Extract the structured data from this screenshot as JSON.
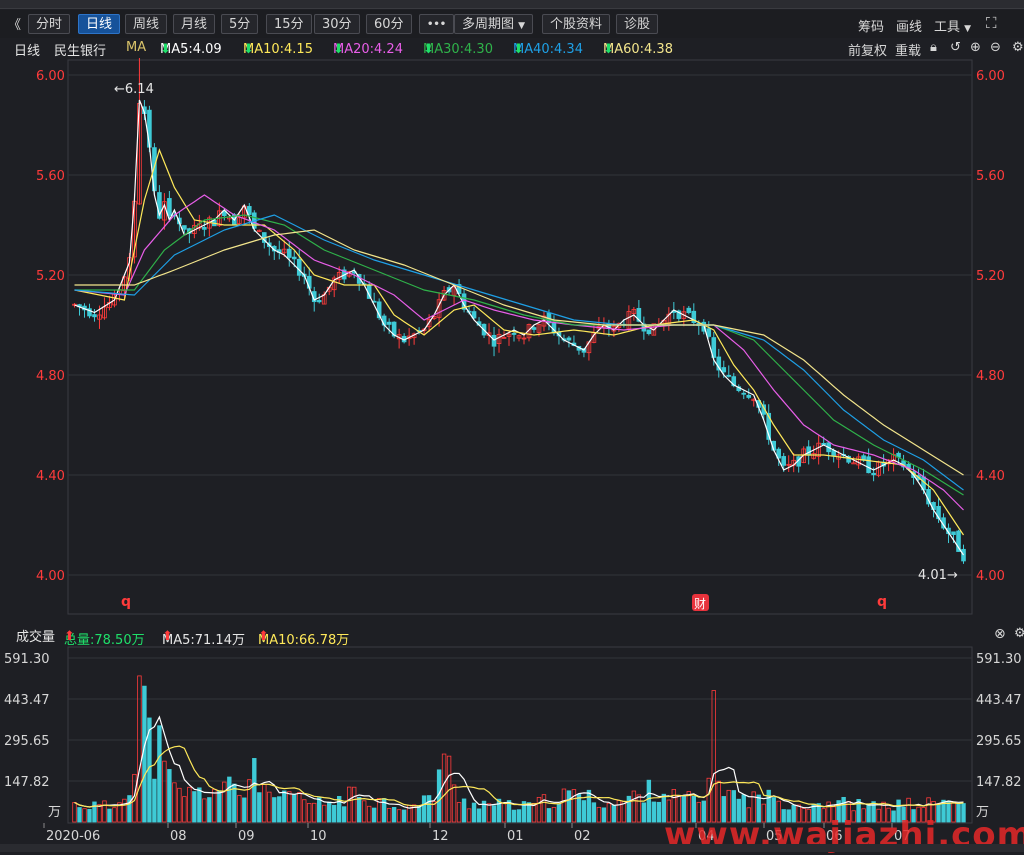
{
  "toolbar": {
    "collapse": "《",
    "tabs": [
      "分时",
      "日线",
      "周线",
      "月线",
      "5分",
      "15分",
      "30分",
      "60分"
    ],
    "active_tab": "日线",
    "more": "•••",
    "multi_period": "多周期图",
    "stock_info": "个股资料",
    "diagnose": "诊股",
    "chips": "筹码",
    "draw": "画线",
    "tools": "工具"
  },
  "info": {
    "period": "日线",
    "stock_name": "民生银行",
    "ma_label": "MA",
    "ma5": "MA5:4.09",
    "ma10": "MA10:4.15",
    "ma20": "MA20:4.24",
    "ma30": "MA30:4.30",
    "ma40": "MA40:4.34",
    "ma60": "MA60:4.38",
    "adjust": "前复权",
    "reload": "重载"
  },
  "volume_info": {
    "label": "成交量",
    "total": "总量:78.50万",
    "vma5": "MA5:71.14万",
    "vma10": "MA10:66.78万"
  },
  "colors": {
    "up": "#ff3b3b",
    "down": "#3ecad6",
    "ma5": "#ffffff",
    "ma10": "#ffe95a",
    "ma20": "#e85ee8",
    "ma30": "#2fb24a",
    "ma40": "#1ea0e6",
    "ma60": "#f3e58c"
  },
  "annotations": {
    "high": "←6.14",
    "low": "4.01→",
    "marker_q": "q",
    "marker_cai": "财"
  },
  "watermark": "www.wajiazhi.com",
  "chart_data": [
    {
      "type": "candlestick",
      "y_ticks": [
        "6.00",
        "5.60",
        "5.20",
        "4.80",
        "4.40",
        "4.00"
      ],
      "ylim": [
        4.0,
        6.2
      ],
      "price_path": [
        [
          0,
          5.08
        ],
        [
          4,
          5.05
        ],
        [
          8,
          5.1
        ],
        [
          11,
          5.25
        ],
        [
          12,
          5.5
        ],
        [
          13,
          5.9
        ],
        [
          14,
          5.85
        ],
        [
          15,
          5.72
        ],
        [
          16,
          5.52
        ],
        [
          17,
          5.44
        ],
        [
          18,
          5.48
        ],
        [
          19,
          5.42
        ],
        [
          20,
          5.46
        ],
        [
          22,
          5.36
        ],
        [
          24,
          5.38
        ],
        [
          26,
          5.4
        ],
        [
          28,
          5.42
        ],
        [
          30,
          5.46
        ],
        [
          32,
          5.42
        ],
        [
          34,
          5.48
        ],
        [
          36,
          5.38
        ],
        [
          38,
          5.34
        ],
        [
          40,
          5.3
        ],
        [
          42,
          5.28
        ],
        [
          44,
          5.24
        ],
        [
          46,
          5.2
        ],
        [
          48,
          5.1
        ],
        [
          50,
          5.12
        ],
        [
          52,
          5.18
        ],
        [
          54,
          5.2
        ],
        [
          56,
          5.22
        ],
        [
          58,
          5.16
        ],
        [
          60,
          5.08
        ],
        [
          62,
          5.0
        ],
        [
          64,
          4.96
        ],
        [
          66,
          4.94
        ],
        [
          68,
          4.96
        ],
        [
          70,
          4.98
        ],
        [
          72,
          5.04
        ],
        [
          74,
          5.12
        ],
        [
          76,
          5.16
        ],
        [
          78,
          5.08
        ],
        [
          80,
          5.02
        ],
        [
          82,
          4.98
        ],
        [
          84,
          4.94
        ],
        [
          86,
          4.96
        ],
        [
          88,
          4.98
        ],
        [
          90,
          4.96
        ],
        [
          92,
          5.0
        ],
        [
          94,
          5.02
        ],
        [
          96,
          4.98
        ],
        [
          98,
          4.94
        ],
        [
          100,
          4.92
        ],
        [
          102,
          4.9
        ],
        [
          104,
          4.96
        ],
        [
          106,
          5.0
        ],
        [
          108,
          4.98
        ],
        [
          110,
          5.02
        ],
        [
          112,
          5.04
        ],
        [
          114,
          5.0
        ],
        [
          116,
          4.98
        ],
        [
          118,
          5.02
        ],
        [
          120,
          5.06
        ],
        [
          122,
          5.04
        ],
        [
          124,
          5.02
        ],
        [
          126,
          5.0
        ],
        [
          128,
          4.86
        ],
        [
          130,
          4.8
        ],
        [
          132,
          4.76
        ],
        [
          134,
          4.74
        ],
        [
          136,
          4.72
        ],
        [
          138,
          4.62
        ],
        [
          140,
          4.5
        ],
        [
          142,
          4.42
        ],
        [
          144,
          4.44
        ],
        [
          146,
          4.48
        ],
        [
          148,
          4.5
        ],
        [
          150,
          4.52
        ],
        [
          152,
          4.5
        ],
        [
          154,
          4.48
        ],
        [
          156,
          4.46
        ],
        [
          158,
          4.44
        ],
        [
          160,
          4.42
        ],
        [
          162,
          4.44
        ],
        [
          164,
          4.46
        ],
        [
          166,
          4.44
        ],
        [
          168,
          4.4
        ],
        [
          170,
          4.34
        ],
        [
          172,
          4.26
        ],
        [
          174,
          4.2
        ],
        [
          176,
          4.14
        ],
        [
          178,
          4.08
        ]
      ],
      "ma_paths": {
        "ma10": [
          [
            0,
            5.14
          ],
          [
            10,
            5.1
          ],
          [
            14,
            5.5
          ],
          [
            17,
            5.7
          ],
          [
            20,
            5.55
          ],
          [
            24,
            5.42
          ],
          [
            30,
            5.4
          ],
          [
            38,
            5.4
          ],
          [
            44,
            5.3
          ],
          [
            48,
            5.2
          ],
          [
            54,
            5.16
          ],
          [
            60,
            5.16
          ],
          [
            64,
            5.04
          ],
          [
            70,
            4.96
          ],
          [
            76,
            5.06
          ],
          [
            80,
            5.08
          ],
          [
            86,
            4.98
          ],
          [
            92,
            4.96
          ],
          [
            100,
            4.98
          ],
          [
            108,
            4.96
          ],
          [
            116,
            5.0
          ],
          [
            124,
            5.02
          ],
          [
            128,
            4.98
          ],
          [
            132,
            4.84
          ],
          [
            136,
            4.74
          ],
          [
            140,
            4.6
          ],
          [
            144,
            4.48
          ],
          [
            150,
            4.48
          ],
          [
            158,
            4.46
          ],
          [
            166,
            4.44
          ],
          [
            172,
            4.34
          ],
          [
            178,
            4.16
          ]
        ],
        "ma20": [
          [
            0,
            5.14
          ],
          [
            10,
            5.12
          ],
          [
            14,
            5.3
          ],
          [
            20,
            5.44
          ],
          [
            26,
            5.52
          ],
          [
            32,
            5.44
          ],
          [
            40,
            5.38
          ],
          [
            48,
            5.26
          ],
          [
            56,
            5.2
          ],
          [
            64,
            5.12
          ],
          [
            70,
            5.02
          ],
          [
            78,
            5.1
          ],
          [
            84,
            5.06
          ],
          [
            92,
            5.02
          ],
          [
            100,
            5.0
          ],
          [
            110,
            4.98
          ],
          [
            120,
            5.0
          ],
          [
            128,
            5.0
          ],
          [
            134,
            4.9
          ],
          [
            140,
            4.74
          ],
          [
            146,
            4.6
          ],
          [
            152,
            4.52
          ],
          [
            160,
            4.48
          ],
          [
            168,
            4.42
          ],
          [
            174,
            4.34
          ],
          [
            178,
            4.26
          ]
        ],
        "ma30": [
          [
            0,
            5.14
          ],
          [
            12,
            5.14
          ],
          [
            18,
            5.3
          ],
          [
            26,
            5.42
          ],
          [
            34,
            5.44
          ],
          [
            42,
            5.4
          ],
          [
            50,
            5.3
          ],
          [
            60,
            5.22
          ],
          [
            70,
            5.14
          ],
          [
            80,
            5.1
          ],
          [
            90,
            5.04
          ],
          [
            100,
            5.0
          ],
          [
            110,
            5.0
          ],
          [
            120,
            5.0
          ],
          [
            128,
            5.0
          ],
          [
            136,
            4.94
          ],
          [
            144,
            4.78
          ],
          [
            152,
            4.62
          ],
          [
            160,
            4.52
          ],
          [
            170,
            4.42
          ],
          [
            178,
            4.32
          ]
        ],
        "ma40": [
          [
            0,
            5.14
          ],
          [
            12,
            5.12
          ],
          [
            20,
            5.28
          ],
          [
            30,
            5.38
          ],
          [
            40,
            5.44
          ],
          [
            50,
            5.34
          ],
          [
            60,
            5.26
          ],
          [
            70,
            5.2
          ],
          [
            80,
            5.14
          ],
          [
            90,
            5.08
          ],
          [
            100,
            5.02
          ],
          [
            110,
            5.0
          ],
          [
            120,
            5.0
          ],
          [
            128,
            5.0
          ],
          [
            138,
            4.94
          ],
          [
            146,
            4.82
          ],
          [
            154,
            4.66
          ],
          [
            162,
            4.54
          ],
          [
            170,
            4.46
          ],
          [
            178,
            4.34
          ]
        ],
        "ma60": [
          [
            0,
            5.16
          ],
          [
            12,
            5.16
          ],
          [
            20,
            5.22
          ],
          [
            30,
            5.3
          ],
          [
            40,
            5.36
          ],
          [
            48,
            5.38
          ],
          [
            56,
            5.3
          ],
          [
            66,
            5.24
          ],
          [
            76,
            5.16
          ],
          [
            86,
            5.08
          ],
          [
            96,
            5.02
          ],
          [
            106,
            5.0
          ],
          [
            116,
            5.0
          ],
          [
            128,
            5.0
          ],
          [
            138,
            4.96
          ],
          [
            146,
            4.86
          ],
          [
            154,
            4.72
          ],
          [
            162,
            4.6
          ],
          [
            170,
            4.5
          ],
          [
            178,
            4.4
          ]
        ]
      }
    },
    {
      "type": "bar",
      "y_ticks": [
        "591.30",
        "443.47",
        "295.65",
        "147.82"
      ],
      "unit_label": "万",
      "ylim": [
        0,
        620
      ],
      "x_ticks": [
        "2020-06",
        "08",
        "09",
        "10",
        "12",
        "01",
        "02",
        "04",
        "05",
        "06",
        "07"
      ],
      "volume_peaks": [
        [
          0,
          70
        ],
        [
          8,
          60
        ],
        [
          12,
          200
        ],
        [
          13,
          545
        ],
        [
          14,
          460
        ],
        [
          15,
          330
        ],
        [
          16,
          260
        ],
        [
          17,
          300
        ],
        [
          18,
          200
        ],
        [
          20,
          130
        ],
        [
          24,
          110
        ],
        [
          30,
          140
        ],
        [
          32,
          130
        ],
        [
          34,
          110
        ],
        [
          36,
          240
        ],
        [
          38,
          110
        ],
        [
          42,
          90
        ],
        [
          44,
          100
        ],
        [
          48,
          70
        ],
        [
          52,
          80
        ],
        [
          56,
          110
        ],
        [
          60,
          90
        ],
        [
          64,
          70
        ],
        [
          68,
          60
        ],
        [
          70,
          80
        ],
        [
          72,
          110
        ],
        [
          74,
          300
        ],
        [
          76,
          120
        ],
        [
          78,
          80
        ],
        [
          84,
          70
        ],
        [
          90,
          60
        ],
        [
          96,
          90
        ],
        [
          100,
          110
        ],
        [
          104,
          90
        ],
        [
          108,
          70
        ],
        [
          112,
          100
        ],
        [
          116,
          130
        ],
        [
          120,
          100
        ],
        [
          126,
          80
        ],
        [
          128,
          380
        ],
        [
          130,
          120
        ],
        [
          134,
          90
        ],
        [
          138,
          100
        ],
        [
          142,
          80
        ],
        [
          146,
          70
        ],
        [
          152,
          80
        ],
        [
          156,
          70
        ],
        [
          160,
          60
        ],
        [
          166,
          70
        ],
        [
          170,
          70
        ],
        [
          174,
          80
        ],
        [
          178,
          70
        ]
      ]
    }
  ]
}
